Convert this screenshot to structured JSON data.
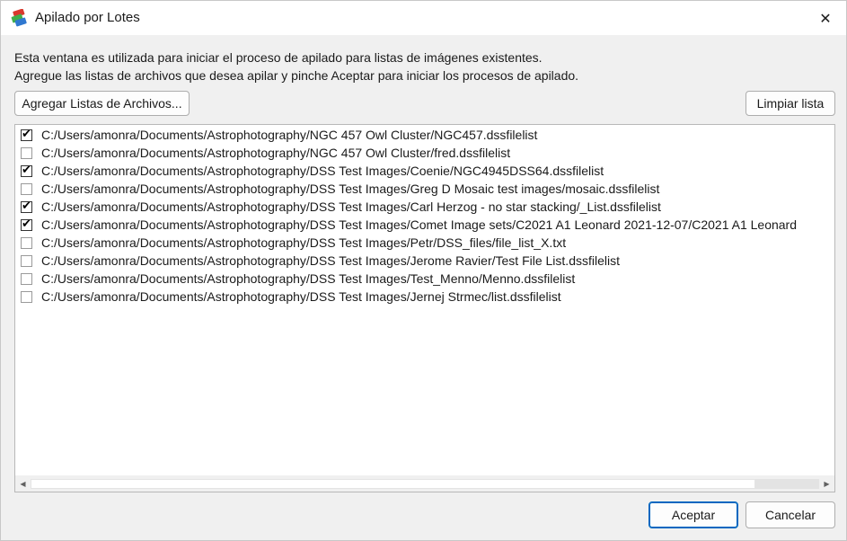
{
  "window": {
    "title": "Apilado por Lotes",
    "close_symbol": "✕"
  },
  "description": {
    "line1": "Esta ventana es utilizada para iniciar el proceso de apilado para listas de imágenes existentes.",
    "line2": "Agregue las listas de archivos que desea apilar y pinche Aceptar para iniciar los procesos de apilado."
  },
  "toolbar": {
    "add_label": "Agregar Listas de Archivos...",
    "clear_label": "Limpiar lista"
  },
  "file_list": {
    "items": [
      {
        "path": "C:/Users/amonra/Documents/Astrophotography/NGC 457 Owl Cluster/NGC457.dssfilelist",
        "checked": true
      },
      {
        "path": "C:/Users/amonra/Documents/Astrophotography/NGC 457 Owl Cluster/fred.dssfilelist",
        "checked": false
      },
      {
        "path": "C:/Users/amonra/Documents/Astrophotography/DSS Test Images/Coenie/NGC4945DSS64.dssfilelist",
        "checked": true
      },
      {
        "path": "C:/Users/amonra/Documents/Astrophotography/DSS Test Images/Greg D Mosaic test images/mosaic.dssfilelist",
        "checked": false
      },
      {
        "path": "C:/Users/amonra/Documents/Astrophotography/DSS Test Images/Carl Herzog - no star stacking/_List.dssfilelist",
        "checked": true
      },
      {
        "path": "C:/Users/amonra/Documents/Astrophotography/DSS Test Images/Comet Image sets/C2021 A1 Leonard 2021-12-07/C2021 A1 Leonard",
        "checked": true
      },
      {
        "path": "C:/Users/amonra/Documents/Astrophotography/DSS Test Images/Petr/DSS_files/file_list_X.txt",
        "checked": false
      },
      {
        "path": "C:/Users/amonra/Documents/Astrophotography/DSS Test Images/Jerome Ravier/Test File List.dssfilelist",
        "checked": false
      },
      {
        "path": "C:/Users/amonra/Documents/Astrophotography/DSS Test Images/Test_Menno/Menno.dssfilelist",
        "checked": false
      },
      {
        "path": "C:/Users/amonra/Documents/Astrophotography/DSS Test Images/Jernej Strmec/list.dssfilelist",
        "checked": false
      }
    ],
    "check_glyph": "✔",
    "scroll_left_glyph": "◀",
    "scroll_right_glyph": "▶"
  },
  "footer": {
    "ok_label": "Aceptar",
    "cancel_label": "Cancelar"
  },
  "colors": {
    "accent": "#0067c0",
    "app_icon_red": "#d9382c",
    "app_icon_green": "#3fae49",
    "app_icon_blue": "#2f78d0"
  }
}
